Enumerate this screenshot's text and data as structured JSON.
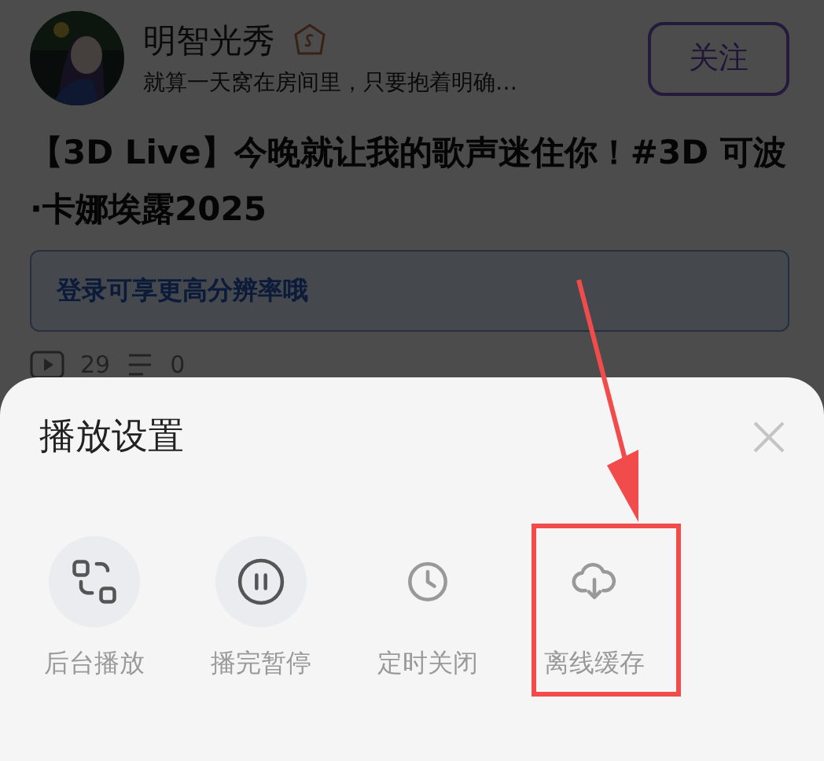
{
  "post": {
    "author": "明智光秀",
    "bio": "就算一天窝在房间里，只要抱着明确…",
    "follow_button": "关注",
    "title": "【3D Live】今晚就让我的歌声迷住你！#3D 可波·卡娜埃露2025",
    "login_banner": "登录可享更高分辨率哦",
    "stats": [
      {
        "kind": "play",
        "value": "29"
      },
      {
        "kind": "comment",
        "value": "0"
      }
    ]
  },
  "sheet": {
    "title": "播放设置",
    "options": [
      {
        "kind": "background",
        "label": "后台播放",
        "highlighted": true,
        "marked": false
      },
      {
        "kind": "pause",
        "label": "播完暂停",
        "highlighted": true,
        "marked": false
      },
      {
        "kind": "timer",
        "label": "定时关闭",
        "highlighted": false,
        "marked": false
      },
      {
        "kind": "download",
        "label": "离线缓存",
        "highlighted": false,
        "marked": true
      }
    ]
  }
}
